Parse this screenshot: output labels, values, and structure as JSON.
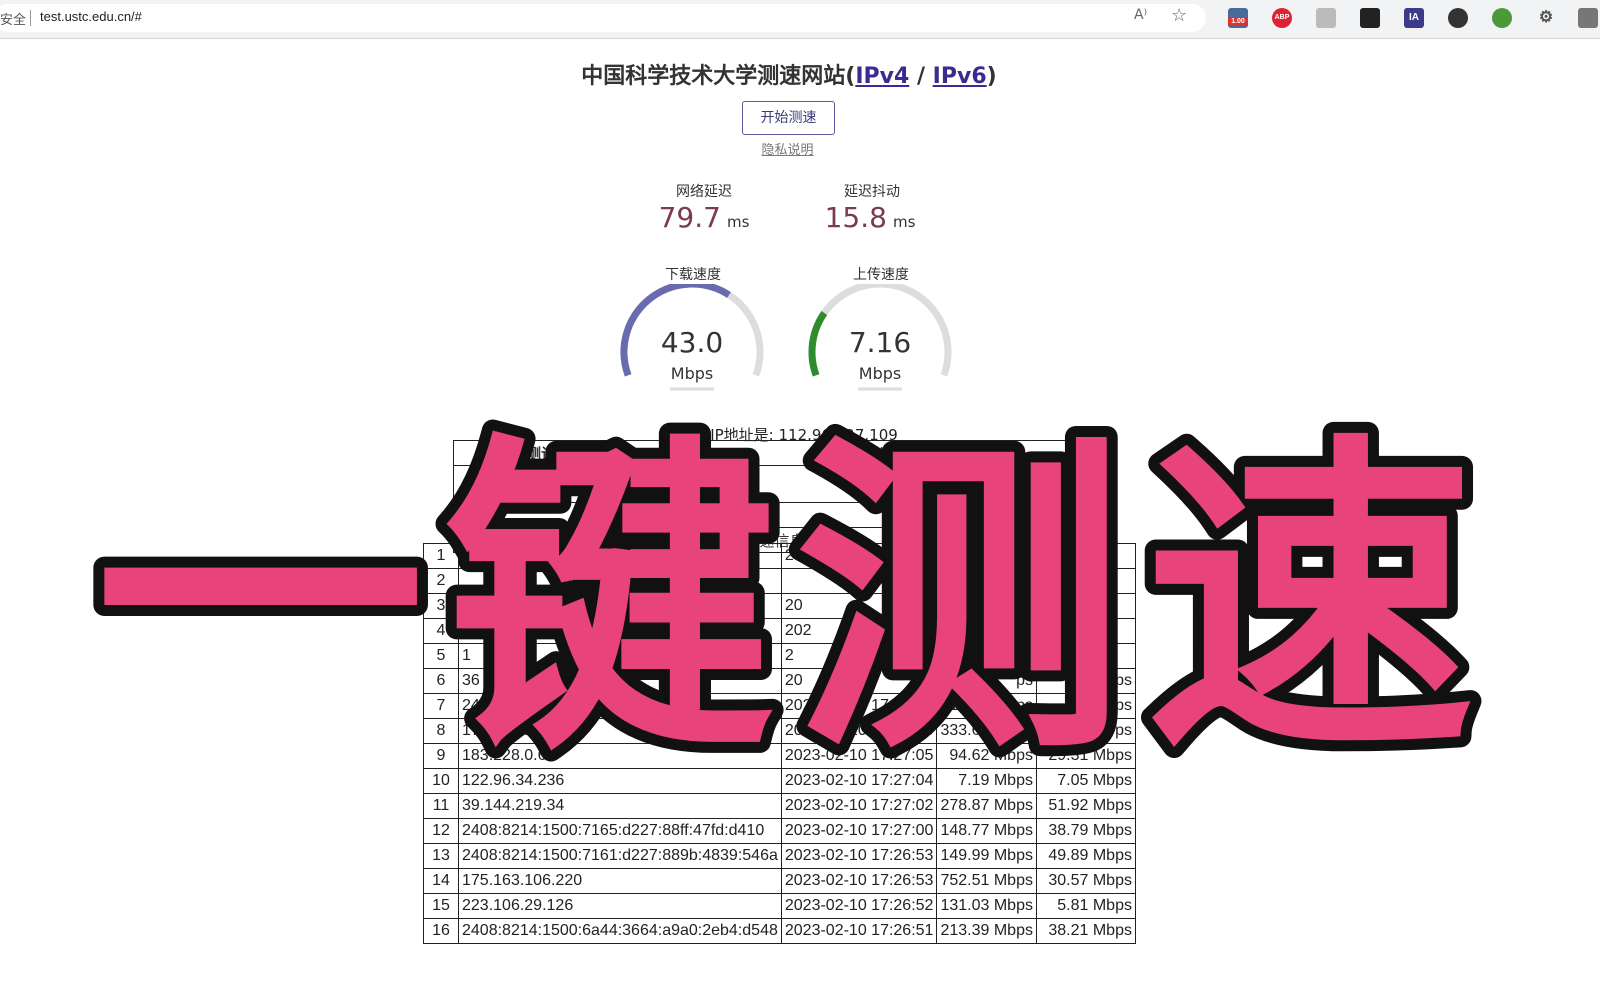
{
  "browser": {
    "security_label": "安全",
    "url": "test.ustc.edu.cn/#",
    "read_aloud": "A⁾",
    "ext_badge": "1.00",
    "abp_label": "ABP",
    "ia_label": "IA"
  },
  "page": {
    "title_prefix": "中国科学技术大学测速网站(",
    "ipv4_link": "IPv4",
    "title_sep": " / ",
    "ipv6_link": "IPv6",
    "title_suffix": ")",
    "start_button": "开始测速",
    "privacy_link": "隐私说明"
  },
  "metrics": {
    "latency_label": "网络延迟",
    "latency_value": "79.7",
    "latency_unit": "ms",
    "jitter_label": "延迟抖动",
    "jitter_value": "15.8",
    "jitter_unit": "ms"
  },
  "gauges": {
    "download_label": "下载速度",
    "download_value": "43.0",
    "download_unit": "Mbps",
    "download_fraction": 0.65,
    "download_color": "#6a6aae",
    "upload_label": "上传速度",
    "upload_value": "7.16",
    "upload_unit": "Mbps",
    "upload_fraction": 0.25,
    "upload_color": "#2e8b2e"
  },
  "ip_line": "您的IP地址是: 112.96.227.109",
  "summary": {
    "col_result": "测试结果",
    "col_conclusion": "结",
    "col_advice": "建 议",
    "row_value": "43.02 Mbps",
    "row2_text": "果",
    "row2_text2": "是否正常",
    "row3_text": "近期测速信息"
  },
  "history_rows": [
    {
      "n": "1",
      "ip": "11",
      "time": "20",
      "down": "",
      "up": ""
    },
    {
      "n": "2",
      "ip": "",
      "time": "",
      "down": "",
      "up": ""
    },
    {
      "n": "3",
      "ip": "",
      "time": "20",
      "down": "",
      "up": ""
    },
    {
      "n": "4",
      "ip": "3",
      "time": "202",
      "down": "Mbps",
      "up": ""
    },
    {
      "n": "5",
      "ip": "1",
      "time": "2",
      "down": "ps",
      "up": ""
    },
    {
      "n": "6",
      "ip": "36",
      "time": "20",
      "down": "ps",
      "up": "bps"
    },
    {
      "n": "7",
      "ip": "2408:8214:150",
      "time": "2023-02-10 17:27:10",
      "down": "161.2 Mbps",
      "up": "Mbps"
    },
    {
      "n": "8",
      "ip": "175.163.106.220",
      "time": "2023-02-10 17:27:06",
      "down": "333.61 Mbps",
      "up": "0.00 Mbps"
    },
    {
      "n": "9",
      "ip": "183.228.0.64",
      "time": "2023-02-10 17:27:05",
      "down": "94.62 Mbps",
      "up": "29.31 Mbps"
    },
    {
      "n": "10",
      "ip": "122.96.34.236",
      "time": "2023-02-10 17:27:04",
      "down": "7.19 Mbps",
      "up": "7.05 Mbps"
    },
    {
      "n": "11",
      "ip": "39.144.219.34",
      "time": "2023-02-10 17:27:02",
      "down": "278.87 Mbps",
      "up": "51.92 Mbps"
    },
    {
      "n": "12",
      "ip": "2408:8214:1500:7165:d227:88ff:47fd:d410",
      "time": "2023-02-10 17:27:00",
      "down": "148.77 Mbps",
      "up": "38.79 Mbps"
    },
    {
      "n": "13",
      "ip": "2408:8214:1500:7161:d227:889b:4839:546a",
      "time": "2023-02-10 17:26:53",
      "down": "149.99 Mbps",
      "up": "49.89 Mbps"
    },
    {
      "n": "14",
      "ip": "175.163.106.220",
      "time": "2023-02-10 17:26:53",
      "down": "752.51 Mbps",
      "up": "30.57 Mbps"
    },
    {
      "n": "15",
      "ip": "223.106.29.126",
      "time": "2023-02-10 17:26:52",
      "down": "131.03 Mbps",
      "up": "5.81 Mbps"
    },
    {
      "n": "16",
      "ip": "2408:8214:1500:6a44:3664:a9a0:2eb4:d548",
      "time": "2023-02-10 17:26:51",
      "down": "213.39 Mbps",
      "up": "38.21 Mbps"
    }
  ],
  "overlay": {
    "text": "一键测速",
    "fill": "#e8437a",
    "stroke": "#111111"
  }
}
